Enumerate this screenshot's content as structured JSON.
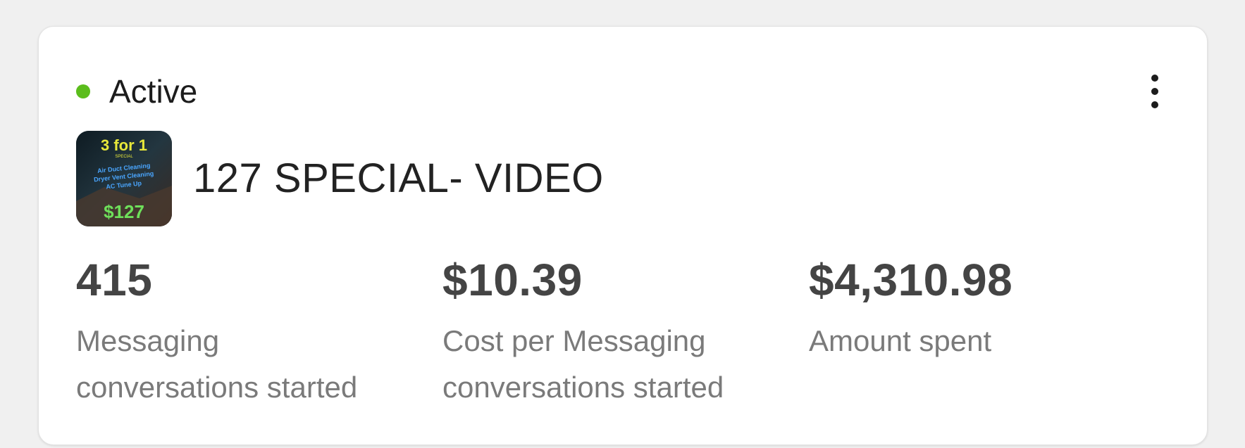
{
  "status": {
    "label": "Active",
    "color": "#5bbd1c"
  },
  "menu": {
    "icon": "more-vertical-icon"
  },
  "ad": {
    "title": "127 SPECIAL- VIDEO",
    "thumbnail": {
      "headline": "3 for 1",
      "subline": "SPECIAL",
      "lines": [
        "Air Duct Cleaning",
        "Dryer Vent Cleaning",
        "AC Tune Up"
      ],
      "price": "$127"
    }
  },
  "metrics": [
    {
      "value": "415",
      "label": "Messaging conversations started"
    },
    {
      "value": "$10.39",
      "label": "Cost per Messaging conversations started"
    },
    {
      "value": "$4,310.98",
      "label": "Amount spent"
    }
  ]
}
